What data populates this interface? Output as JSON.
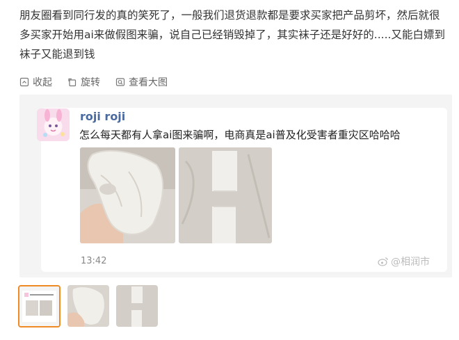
{
  "post": {
    "text": "朋友圈看到同行发的真的笑死了，一般我们退货退款都是要求买家把产品剪坏，然后就很多买家开始用ai来做假图来骗，说自己已经销毁掉了，其实袜子还是好好的.....又能白嫖到袜子又能退到钱"
  },
  "toolbar": {
    "collapse_label": "收起",
    "rotate_label": "旋转",
    "view_large_label": "查看大图"
  },
  "screenshot": {
    "username": "roji roji",
    "message": "怎么每天都有人拿ai图来骗啊，电商真是ai普及化受害者重灾区哈哈哈",
    "time": "13:42",
    "watermark": "@相润市"
  },
  "thumbnails": {
    "selected_index": 0,
    "count": 3
  },
  "colors": {
    "accent_orange": "#f08a24",
    "username_blue": "#4a6aa0"
  },
  "icons": [
    "collapse-icon",
    "rotate-icon",
    "view-large-icon",
    "weibo-icon"
  ]
}
